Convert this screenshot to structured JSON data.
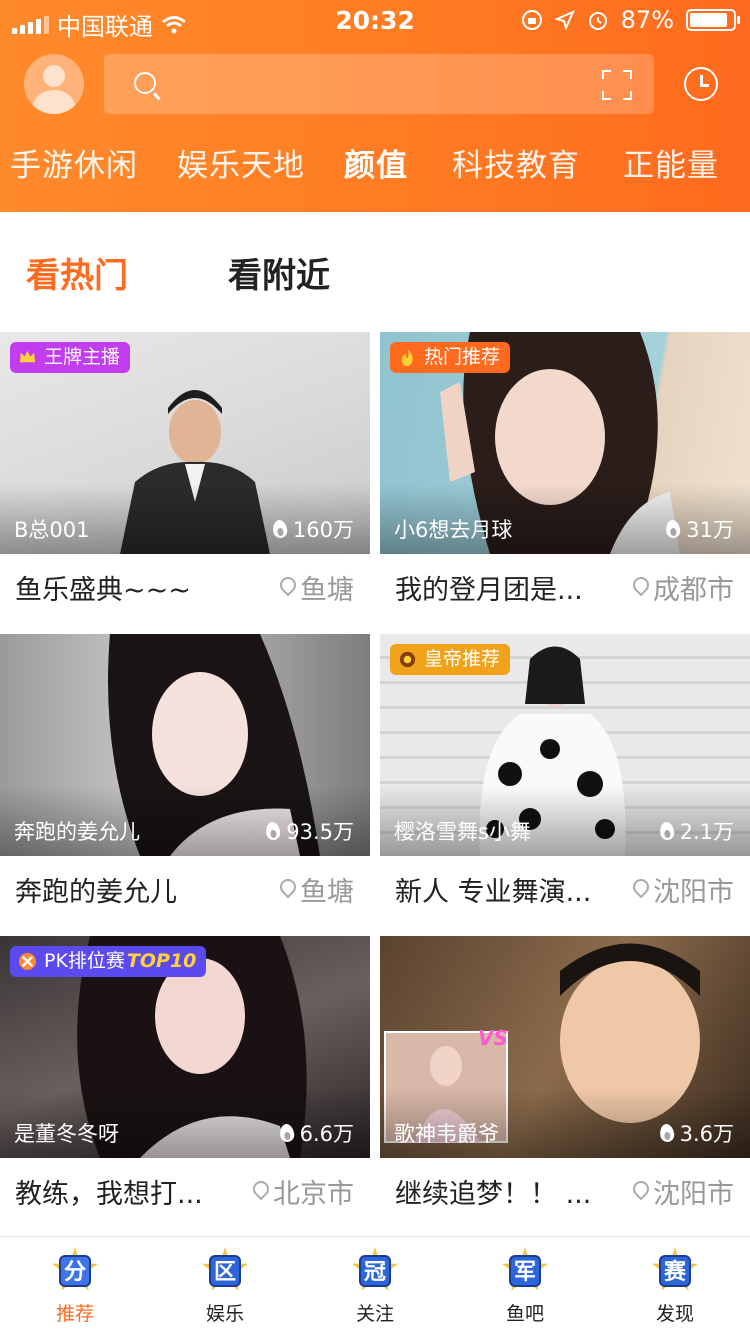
{
  "status": {
    "carrier": "中国联通",
    "time": "20:32",
    "battery": "87%",
    "battery_level": 0.87
  },
  "search": {
    "placeholder": ""
  },
  "categories": [
    "手游休闲",
    "娱乐天地",
    "颜值",
    "科技教育",
    "正能量"
  ],
  "active_category": "颜值",
  "sub_tabs": [
    "看热门",
    "看附近"
  ],
  "active_sub_tab": "看热门",
  "cards": [
    {
      "badge": "王牌主播",
      "badge_suffix": "",
      "badge_color": "#c23cf0",
      "nickname": "B总001",
      "heat": "160万",
      "title": "鱼乐盛典~~~",
      "location": "鱼塘"
    },
    {
      "badge": "热门推荐",
      "badge_suffix": "",
      "badge_color": "#ff6a1e",
      "nickname": "小6想去月球",
      "heat": "31万",
      "title": "我的登月团是...",
      "location": "成都市"
    },
    {
      "badge": "",
      "badge_suffix": "",
      "badge_color": "",
      "nickname": "奔跑的姜允儿",
      "heat": "93.5万",
      "title": "奔跑的姜允儿",
      "location": "鱼塘"
    },
    {
      "badge": "皇帝推荐",
      "badge_suffix": "",
      "badge_color": "#f0a31a",
      "nickname": "樱洛雪舞s小舞",
      "heat": "2.1万",
      "title": "新人 专业舞演...",
      "location": "沈阳市"
    },
    {
      "badge": "PK排位赛",
      "badge_suffix": "TOP10",
      "badge_color": "#5a4af0",
      "nickname": "是董冬冬呀",
      "heat": "6.6万",
      "title": "教练，我想打...",
      "location": "北京市"
    },
    {
      "badge": "",
      "badge_suffix": "",
      "badge_color": "",
      "nickname": "歌神韦爵爷",
      "heat": "3.6万",
      "title": "继续追梦！！ ...",
      "location": "沈阳市"
    }
  ],
  "tabbar": [
    {
      "label": "推荐",
      "glyph": "分",
      "icon": "star-badge-icon"
    },
    {
      "label": "娱乐",
      "glyph": "区",
      "icon": "star-badge-icon"
    },
    {
      "label": "关注",
      "glyph": "冠",
      "icon": "star-badge-icon"
    },
    {
      "label": "鱼吧",
      "glyph": "军",
      "icon": "star-badge-icon"
    },
    {
      "label": "发现",
      "glyph": "赛",
      "icon": "star-badge-icon"
    }
  ],
  "colors": {
    "brand": "#ff7a22",
    "active_text": "#ff6b1f",
    "muted": "#999999"
  }
}
